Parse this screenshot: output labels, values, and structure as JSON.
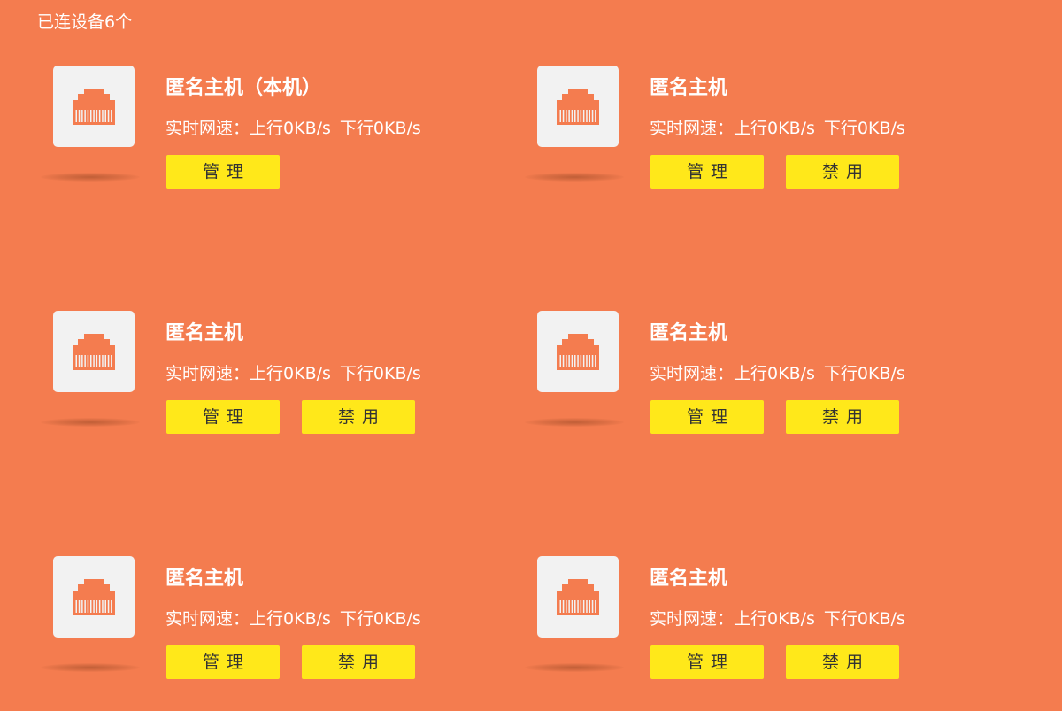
{
  "colors": {
    "background": "#f47c4f",
    "icon_box": "#f2f2f2",
    "icon": "#f47c4f",
    "button": "#ffe81a",
    "text": "#ffffff"
  },
  "header": {
    "title": "已连设备6个"
  },
  "devices": [
    {
      "name": "匿名主机（本机）",
      "speed_label": "实时网速：",
      "upload": "上行0KB/s",
      "download": "下行0KB/s",
      "manage_label": "管理",
      "disable_label": null,
      "icon": "ethernet-port-icon"
    },
    {
      "name": "匿名主机",
      "speed_label": "实时网速：",
      "upload": "上行0KB/s",
      "download": "下行0KB/s",
      "manage_label": "管理",
      "disable_label": "禁用",
      "icon": "ethernet-port-icon"
    },
    {
      "name": "匿名主机",
      "speed_label": "实时网速：",
      "upload": "上行0KB/s",
      "download": "下行0KB/s",
      "manage_label": "管理",
      "disable_label": "禁用",
      "icon": "ethernet-port-icon"
    },
    {
      "name": "匿名主机",
      "speed_label": "实时网速：",
      "upload": "上行0KB/s",
      "download": "下行0KB/s",
      "manage_label": "管理",
      "disable_label": "禁用",
      "icon": "ethernet-port-icon"
    },
    {
      "name": "匿名主机",
      "speed_label": "实时网速：",
      "upload": "上行0KB/s",
      "download": "下行0KB/s",
      "manage_label": "管理",
      "disable_label": "禁用",
      "icon": "ethernet-port-icon"
    },
    {
      "name": "匿名主机",
      "speed_label": "实时网速：",
      "upload": "上行0KB/s",
      "download": "下行0KB/s",
      "manage_label": "管理",
      "disable_label": "禁用",
      "icon": "ethernet-port-icon"
    }
  ]
}
